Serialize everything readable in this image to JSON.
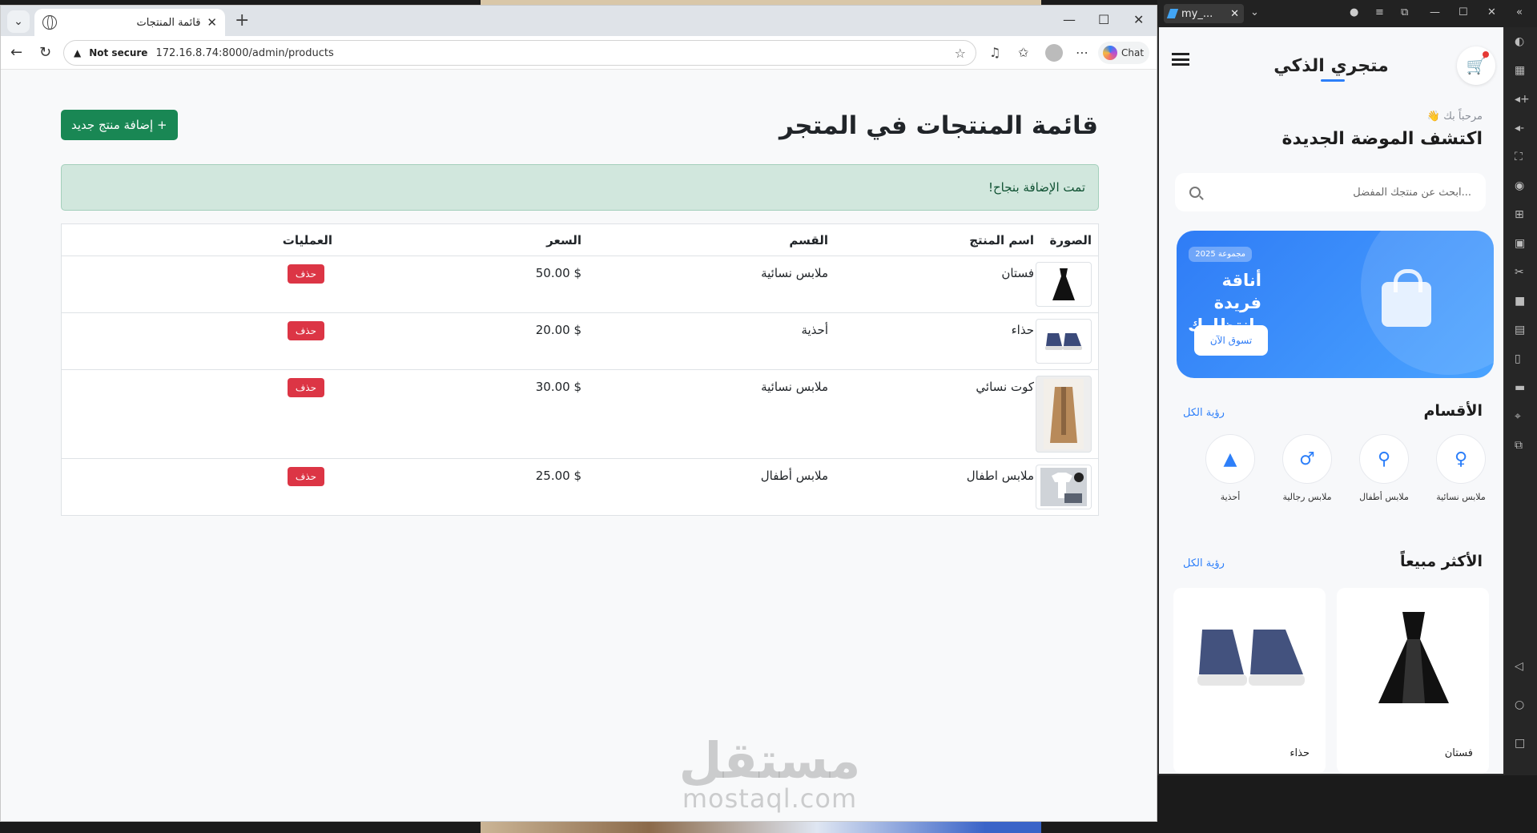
{
  "browser": {
    "tab_title": "قائمة المنتجات",
    "new_tab_glyph": "+",
    "omnibox": {
      "security": "Not secure",
      "url": "172.16.8.74:8000/admin/products"
    },
    "chat_label": "Chat"
  },
  "page": {
    "title": "قائمة المنتجات في المتجر",
    "add_button": "+ إضافة منتج جديد",
    "alert": "تمت الإضافة بنجاح!",
    "table": {
      "headers": [
        "الصورة",
        "اسم المنتج",
        "القسم",
        "السعر",
        "العمليات"
      ],
      "rows": [
        {
          "name": "فستان",
          "category": "ملابس نسائية",
          "price": "$ 50.00",
          "action": "حذف",
          "image": "dress"
        },
        {
          "name": "حذاء",
          "category": "أحذية",
          "price": "$ 20.00",
          "action": "حذف",
          "image": "shoes"
        },
        {
          "name": "كوت نسائي",
          "category": "ملابس نسائية",
          "price": "$ 30.00",
          "action": "حذف",
          "image": "coat"
        },
        {
          "name": "ملابس اطفال",
          "category": "ملابس أطفال",
          "price": "$ 25.00",
          "action": "حذف",
          "image": "kids-clothes"
        }
      ]
    }
  },
  "watermark": {
    "arabic": "مستقل",
    "latin": "mostaql.com"
  },
  "emulator": {
    "window_tab": "my_...",
    "app": {
      "brand": "متجري الذكي",
      "greeting": "مرحباً بك 👋",
      "headline": "اكتشف الموضة الجديدة",
      "search_placeholder": "...ابحث عن منتجك المفضل",
      "banner": {
        "badge": "مجموعة 2025",
        "headline": "أناقة فريدة بانتظارك",
        "cta": "تسوق الآن"
      },
      "categories_title": "الأقسام",
      "see_all": "رؤية الكل",
      "categories": [
        {
          "label": "ملابس نسائية",
          "icon": "woman-icon"
        },
        {
          "label": "ملابس أطفال",
          "icon": "stroller-icon"
        },
        {
          "label": "ملابس رجالية",
          "icon": "man-icon"
        },
        {
          "label": "أحذية",
          "icon": "shapes-icon"
        }
      ],
      "bestsellers_title": "الأكثر مبيعاً",
      "bestsellers": [
        {
          "name": "فستان",
          "image": "dress"
        },
        {
          "name": "حذاء",
          "image": "shoes"
        }
      ]
    }
  },
  "colors": {
    "success": "#198754",
    "danger": "#dc3545",
    "alert_bg": "#d1e7dd",
    "accent_blue": "#2d7ff9"
  }
}
